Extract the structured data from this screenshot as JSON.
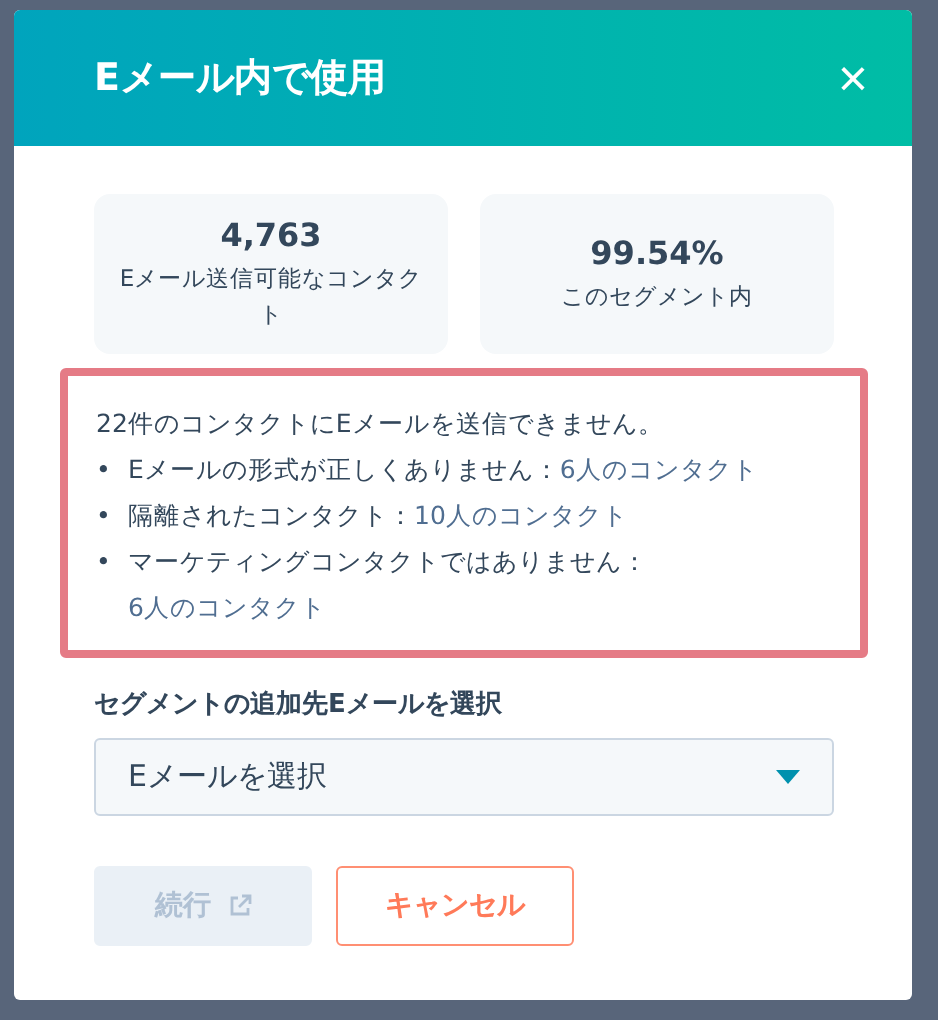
{
  "dialog": {
    "title": "Eメール内で使用",
    "close_icon": "×"
  },
  "stats": [
    {
      "value": "4,763",
      "label": "Eメール送信可能なコンタクト"
    },
    {
      "value": "99.54%",
      "label": "このセグメント内"
    }
  ],
  "alert": {
    "message": "22件のコンタクトにEメールを送信できません。",
    "items": [
      {
        "bullet": "•",
        "reason": "Eメールの形式が正しくありません：",
        "link": "6人のコンタクト"
      },
      {
        "bullet": "•",
        "reason": "隔離されたコンタクト：",
        "link": "10人のコンタクト"
      },
      {
        "bullet": "•",
        "reason": "マーケティングコンタクトではありません：",
        "link": "6人のコンタクト"
      }
    ]
  },
  "email_select": {
    "label": "セグメントの追加先Eメールを選択",
    "placeholder": "Eメールを選択"
  },
  "buttons": [
    {
      "label": "続行",
      "kind": "primary",
      "disabled": true,
      "external": true
    },
    {
      "label": "キャンセル",
      "kind": "secondary",
      "disabled": false,
      "external": false
    }
  ]
}
